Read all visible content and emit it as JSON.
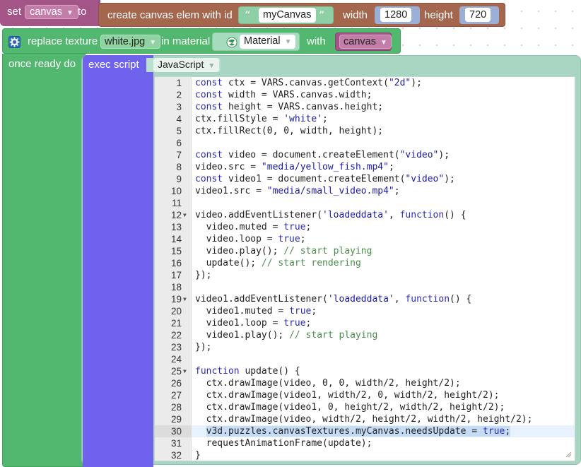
{
  "set_block": {
    "set_label": "set",
    "var_name": "canvas",
    "to_label": "to"
  },
  "create_block": {
    "label": "create canvas elem with id",
    "id_value": "myCanvas",
    "width_label": "width",
    "width_value": "1280",
    "height_label": "height",
    "height_value": "720"
  },
  "replace_block": {
    "label": "replace texture",
    "texture_value": "white.jpg",
    "in_label": "in material",
    "material_value": "Material",
    "with_label": "with",
    "with_value": "canvas"
  },
  "ready_block": {
    "label": "once ready do"
  },
  "exec_block": {
    "label": "exec script",
    "language": "JavaScript"
  },
  "code": {
    "active_line": 30,
    "fold_lines": [
      12,
      19,
      25
    ],
    "lines": [
      "const ctx = VARS.canvas.getContext(\"2d\");",
      "const width = VARS.canvas.width;",
      "const height = VARS.canvas.height;",
      "ctx.fillStyle = 'white';",
      "ctx.fillRect(0, 0, width, height);",
      "",
      "const video = document.createElement(\"video\");",
      "video.src = \"media/yellow_fish.mp4\";",
      "const video1 = document.createElement(\"video\");",
      "video1.src = \"media/small_video.mp4\";",
      "",
      "video.addEventListener('loadeddata', function() {",
      "  video.muted = true;",
      "  video.loop = true;",
      "  video.play(); // start playing",
      "  update(); // start rendering",
      "});",
      "",
      "video1.addEventListener('loadeddata', function() {",
      "  video1.muted = true;",
      "  video1.loop = true;",
      "  video1.play(); // start playing",
      "});",
      "",
      "function update() {",
      "  ctx.drawImage(video, 0, 0, width/2, height/2);",
      "  ctx.drawImage(video1, width/2, 0, width/2, height/2);",
      "  ctx.drawImage(video1, 0, height/2, width/2, height/2);",
      "  ctx.drawImage(video, width/2, height/2, width/2, height/2);",
      "  v3d.puzzles.canvasTextures.myCanvas.needsUpdate = true;",
      "  requestAnimationFrame(update);",
      "}"
    ]
  },
  "icons": {
    "gear": "gear-icon",
    "material": "material-sphere-icon",
    "quote_open": "quote-open-icon",
    "quote_close": "quote-close-icon",
    "dropdown": "chevron-down-icon",
    "resize": "resize-handle-icon"
  },
  "colors": {
    "set_block": "#a45587",
    "create_block": "#a5664e",
    "replace_block": "#52b870",
    "exec_block": "#6f63ee",
    "exec_panel": "#a8d6c3",
    "keyword": "#2b2bb8",
    "string": "#1a1aa6",
    "comment": "#4a8e4a"
  }
}
